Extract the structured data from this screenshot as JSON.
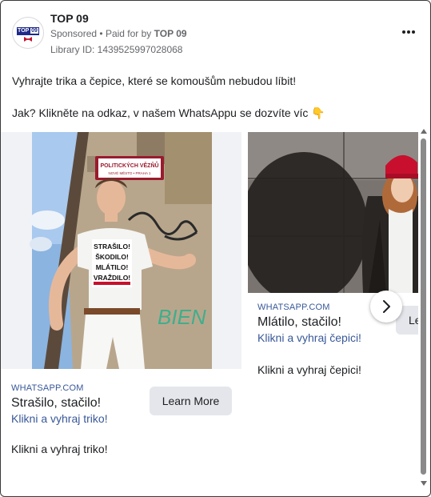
{
  "post": {
    "page_name": "TOP 09",
    "sponsored": "Sponsored",
    "paid_prefix": "Paid for by",
    "paid_by": "TOP 09",
    "library_id": "Library ID: 1439525997028068",
    "avatar_logo_text": "TOP",
    "avatar_logo_num": "09",
    "more_icon": "more-horizontal-icon",
    "text_line1": "Vyhrajte trika a čepice, které se komoušům nebudou líbit!",
    "text_line2": "Jak? Klikněte na odkaz, v našem WhatsAppu se dozvíte víc 👇"
  },
  "cards": [
    {
      "domain": "WHATSAPP.COM",
      "headline": "Strašilo, stačilo!",
      "link_description": "Klikni a vyhraj triko!",
      "cta": "Learn More",
      "description": "Klikni a vyhraj triko!",
      "sign_text": "POLITICKÝCH VĚZŇŮ",
      "sign_sub": "NOVÉ MĚSTO • PRAHA 1",
      "shirt_lines": [
        "STRAŠILO!",
        "ŠKODILO!",
        "MLÁTILO!",
        "VRAŽDILO!"
      ],
      "graffiti": "BIEN"
    },
    {
      "domain": "WHATSAPP.COM",
      "headline": "Mlátilo, stačilo!",
      "link_description": "Klikni a vyhraj čepici!",
      "cta": "Le",
      "description": "Klikni a vyhraj čepici!"
    }
  ],
  "colors": {
    "link": "#385898",
    "brand": "#1e2a8a",
    "cap_red": "#c8102e"
  }
}
